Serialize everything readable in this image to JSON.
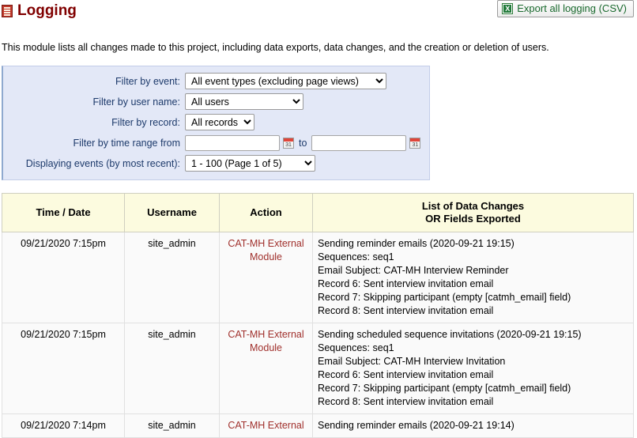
{
  "header": {
    "title": "Logging",
    "title_icon": "report-icon",
    "export_button": {
      "label": "Export all logging (CSV)",
      "icon": "excel-icon"
    }
  },
  "description": "This module lists all changes made to this project, including data exports, data changes, and the creation or deletion of users.",
  "filters": {
    "event": {
      "label": "Filter by event:",
      "value": "All event types (excluding page views)"
    },
    "user": {
      "label": "Filter by user name:",
      "value": "All users"
    },
    "record": {
      "label": "Filter by record:",
      "value": "All records"
    },
    "time_range": {
      "label": "Filter by time range from",
      "from_value": "",
      "from_placeholder": "",
      "to_label": "to",
      "to_value": "",
      "to_placeholder": "",
      "calendar_icon": "calendar-icon"
    },
    "displaying": {
      "label": "Displaying events (by most recent):",
      "value": "1 - 100  (Page 1 of 5)"
    }
  },
  "table": {
    "columns": [
      "Time / Date",
      "Username",
      "Action",
      "List of Data Changes OR Fields Exported"
    ],
    "detail_header_line1": "List of Data Changes",
    "detail_header_line2": "OR Fields Exported",
    "rows": [
      {
        "time": "09/21/2020 7:15pm",
        "username": "site_admin",
        "action": "CAT-MH External Module",
        "details": [
          "Sending reminder emails (2020-09-21 19:15)",
          "Sequences: seq1",
          "Email Subject: CAT-MH Interview Reminder",
          "Record 6: Sent interview invitation email",
          "Record 7: Skipping participant (empty [catmh_email] field)",
          "Record 8: Sent interview invitation email"
        ]
      },
      {
        "time": "09/21/2020 7:15pm",
        "username": "site_admin",
        "action": "CAT-MH External Module",
        "details": [
          "Sending scheduled sequence invitations (2020-09-21 19:15)",
          "Sequences: seq1",
          "Email Subject: CAT-MH Interview Invitation",
          "Record 6: Sent interview invitation email",
          "Record 7: Skipping participant (empty [catmh_email] field)",
          "Record 8: Sent interview invitation email"
        ]
      },
      {
        "time": "09/21/2020 7:14pm",
        "username": "site_admin",
        "action": "CAT-MH External",
        "details": [
          "Sending reminder emails (2020-09-21 19:14)"
        ]
      }
    ]
  },
  "colors": {
    "title": "#800000",
    "panel_bg": "#e3e8f7",
    "label": "#1d3a6b",
    "table_header_bg": "#fcfbdf",
    "action_text": "#a0302c",
    "export_text": "#1a6a2e"
  }
}
